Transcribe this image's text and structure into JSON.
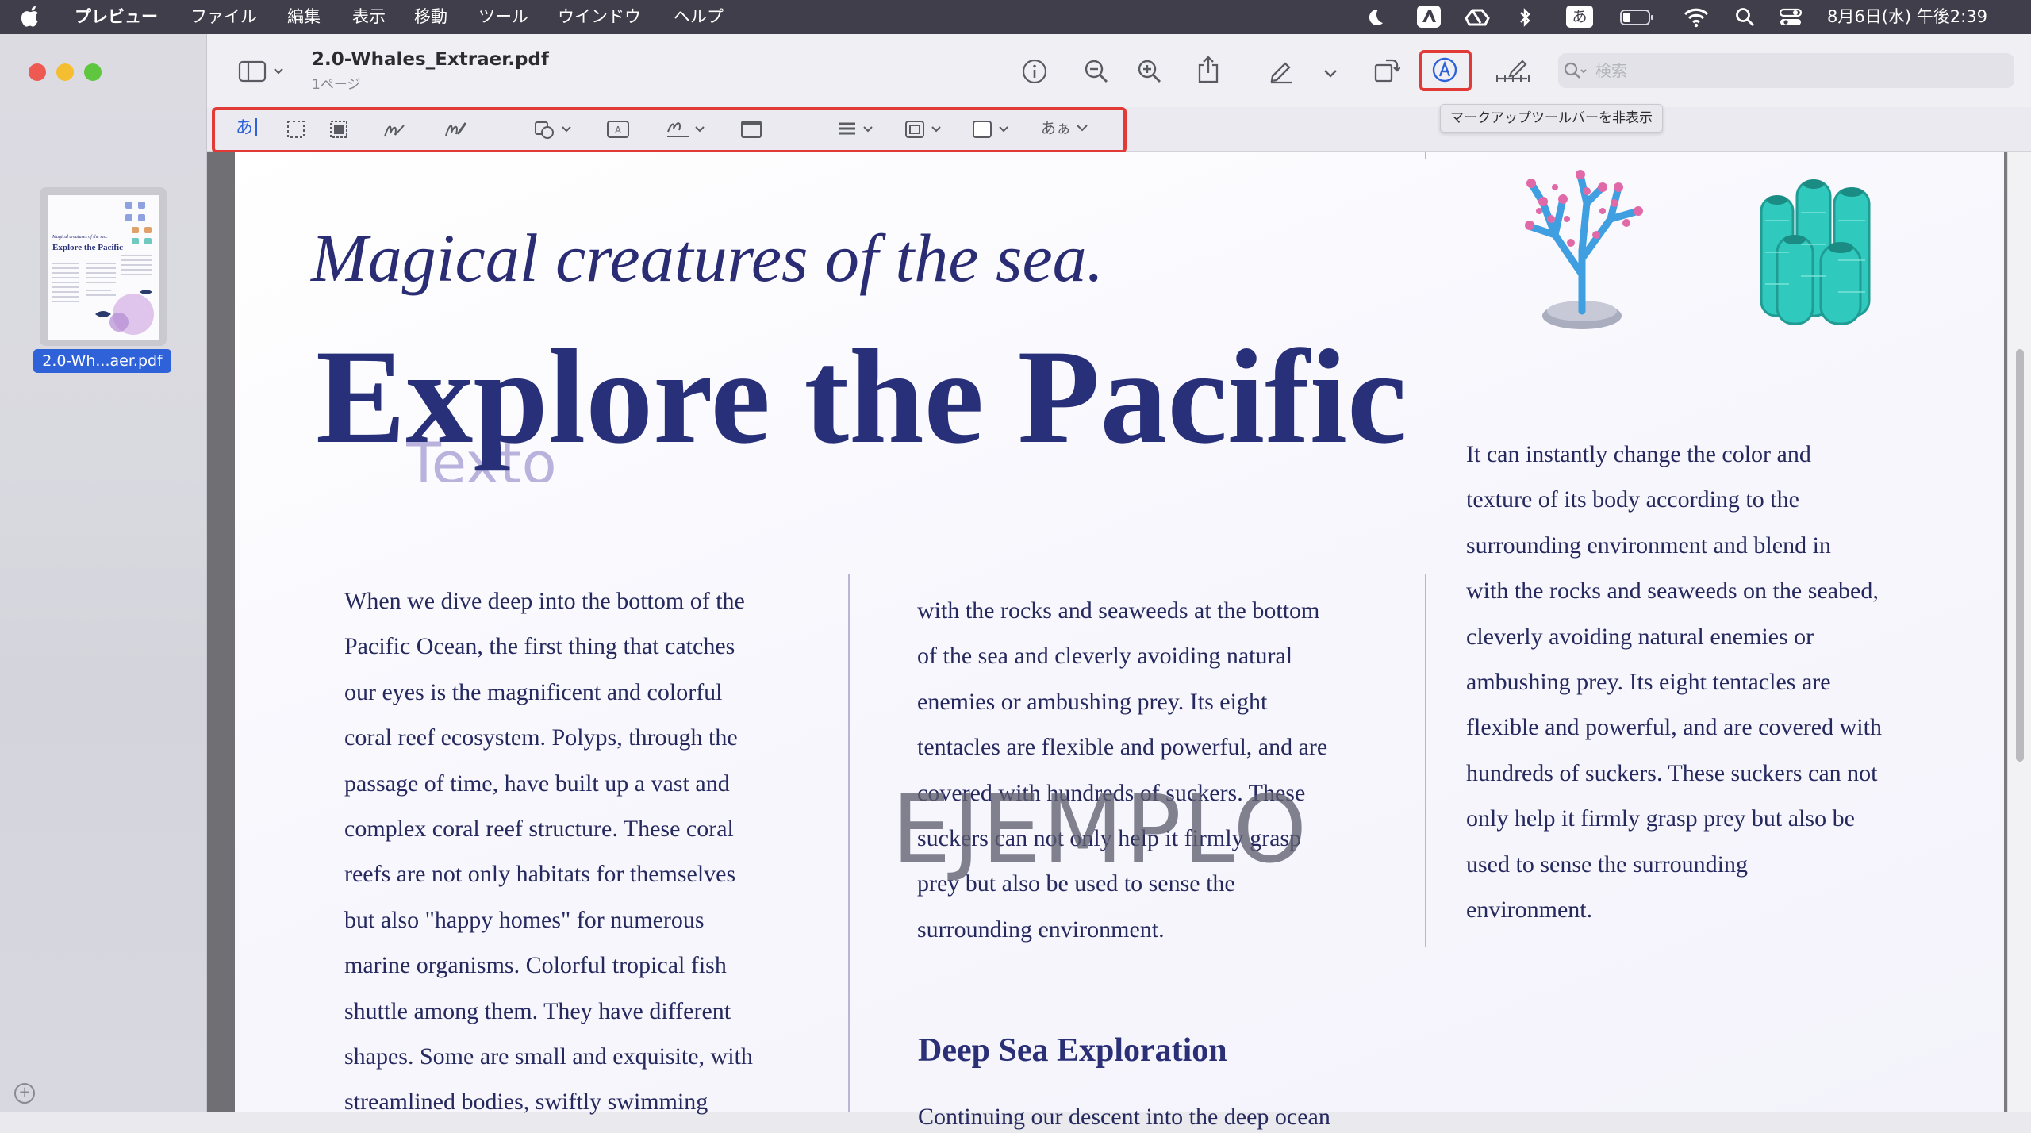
{
  "menubar": {
    "app_name": "プレビュー",
    "menus": [
      "ファイル",
      "編集",
      "表示",
      "移動",
      "ツール",
      "ウインドウ",
      "ヘルプ"
    ],
    "input_mode": "あ",
    "datetime": "8月6日(水) 午後2:39",
    "status_icons": [
      "apple-icon",
      "moon-icon",
      "app-icon",
      "drive-icon",
      "bluetooth-icon",
      "input-source-icon",
      "battery-icon",
      "wifi-icon",
      "spotlight-icon",
      "control-center-icon"
    ]
  },
  "sidebar": {
    "thumbnail_label": "2.0-Wh...aer.pdf",
    "thumbnail_text": {
      "subtitle": "Magical creatures of the sea.",
      "title": "Explore the Pacific"
    }
  },
  "toolbar": {
    "document_title": "2.0-Whales_Extraer.pdf",
    "page_count": "1ページ",
    "search_placeholder": "検索",
    "tooltip": "マークアップツールバーを非表示",
    "buttons": [
      "sidebar-toggle",
      "info",
      "zoom-out",
      "zoom-in",
      "share",
      "highlight",
      "highlight-menu",
      "rotate",
      "markup",
      "form-fill",
      "search"
    ]
  },
  "markup_toolbar": {
    "text_tool_label": "あ",
    "font_tool_label": "あぁ",
    "tools": [
      "text-selection",
      "rectangular-selection",
      "instant-alpha",
      "sketch",
      "draw",
      "shapes",
      "text",
      "sign",
      "note",
      "shape-style",
      "border-color",
      "fill-color",
      "text-style"
    ]
  },
  "document": {
    "subtitle": "Magical creatures of the sea.",
    "title": "Explore the Pacific",
    "overlay_text": "Texto",
    "watermark": "EJEMPLO",
    "column1": [
      "When we dive deep into the bottom of the",
      "Pacific Ocean, the first thing that catches",
      "our eyes is the magnificent and colorful",
      "coral reef ecosystem. Polyps, through the",
      "passage of time, have built up a vast and",
      "complex coral reef structure. These coral",
      "reefs are not only habitats for themselves",
      "but also \"happy homes\" for numerous",
      "marine organisms. Colorful tropical fish",
      "shuttle among them. They have different",
      "shapes. Some are small and exquisite, with",
      "streamlined bodies, swiftly swimming"
    ],
    "column2": [
      "with the rocks and seaweeds at the bottom",
      "of the sea and cleverly avoiding natural",
      "enemies or ambushing prey. Its eight",
      "tentacles are flexible and powerful, and are",
      "covered with hundreds of suckers. These",
      "suckers can not only help it firmly grasp",
      "prey but also be used to sense the",
      "surrounding environment."
    ],
    "column3": [
      "It can instantly change the color and",
      "texture of its body according to the",
      "surrounding environment and blend in",
      "with the rocks and seaweeds on the seabed,",
      "cleverly avoiding natural enemies or",
      "ambushing prey. Its eight tentacles are",
      "flexible and powerful, and are covered with",
      "hundreds of suckers. These suckers can not",
      "only help it firmly grasp prey but also be",
      "used to sense the surrounding",
      "environment."
    ],
    "section_heading": "Deep Sea Exploration",
    "section_text": "Continuing our descent into the deep ocean"
  },
  "colors": {
    "menubar_bg": "#3f3e4a",
    "title_navy": "#29307a",
    "body_text": "#25295e",
    "highlight_red": "#e23a36",
    "selection_blue": "#2f62d9",
    "coral_pink": "#e06aa8",
    "coral_blue": "#3f9fe0",
    "coral_teal": "#30c9bd"
  }
}
